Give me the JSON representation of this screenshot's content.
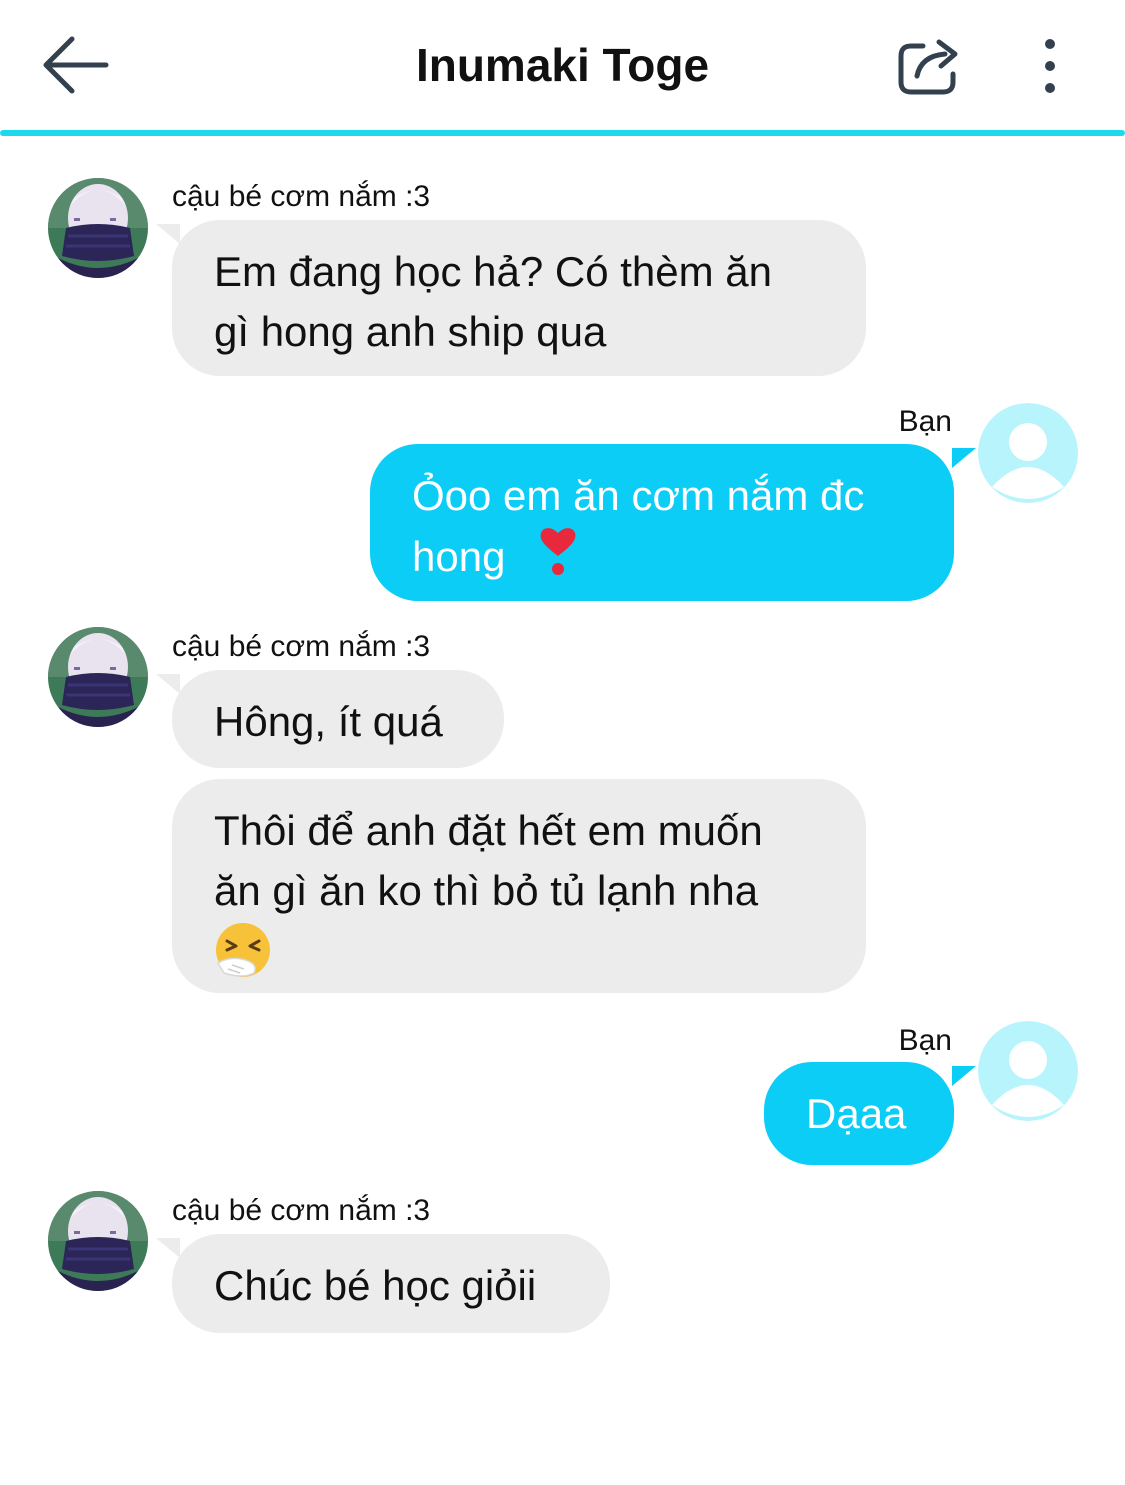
{
  "header": {
    "title": "Inumaki Toge",
    "back_icon": "arrow-left-icon",
    "share_icon": "share-icon",
    "more_icon": "more-vertical-icon",
    "accent_color": "#1dd9ec"
  },
  "colors": {
    "incoming_bubble": "#ececec",
    "outgoing_bubble": "#0ccdf5"
  },
  "messages": [
    {
      "from": "friend",
      "sender": "cậu bé cơm nắm :3",
      "lines": [
        "Em đang học hả? Có thèm ăn",
        "gì hong anh ship qua"
      ]
    },
    {
      "from": "me",
      "sender": "Bạn",
      "lines": [
        "Ỏoo em ăn cơm nắm đc",
        "hong"
      ],
      "emoji": "heart-exclamation-icon"
    },
    {
      "from": "friend",
      "sender": "cậu bé cơm nắm :3",
      "lines": [
        "Hông, ít quá"
      ]
    },
    {
      "from": "friend",
      "lines": [
        "Thôi để anh đặt hết em muốn",
        "ăn gì ăn ko thì bỏ tủ lạnh nha"
      ],
      "emoji": "sneezing-face-icon"
    },
    {
      "from": "me",
      "sender": "Bạn",
      "lines": [
        "Dạaa"
      ]
    },
    {
      "from": "friend",
      "sender": "cậu bé cơm nắm :3",
      "lines": [
        "Chúc bé học giỏii"
      ]
    }
  ]
}
